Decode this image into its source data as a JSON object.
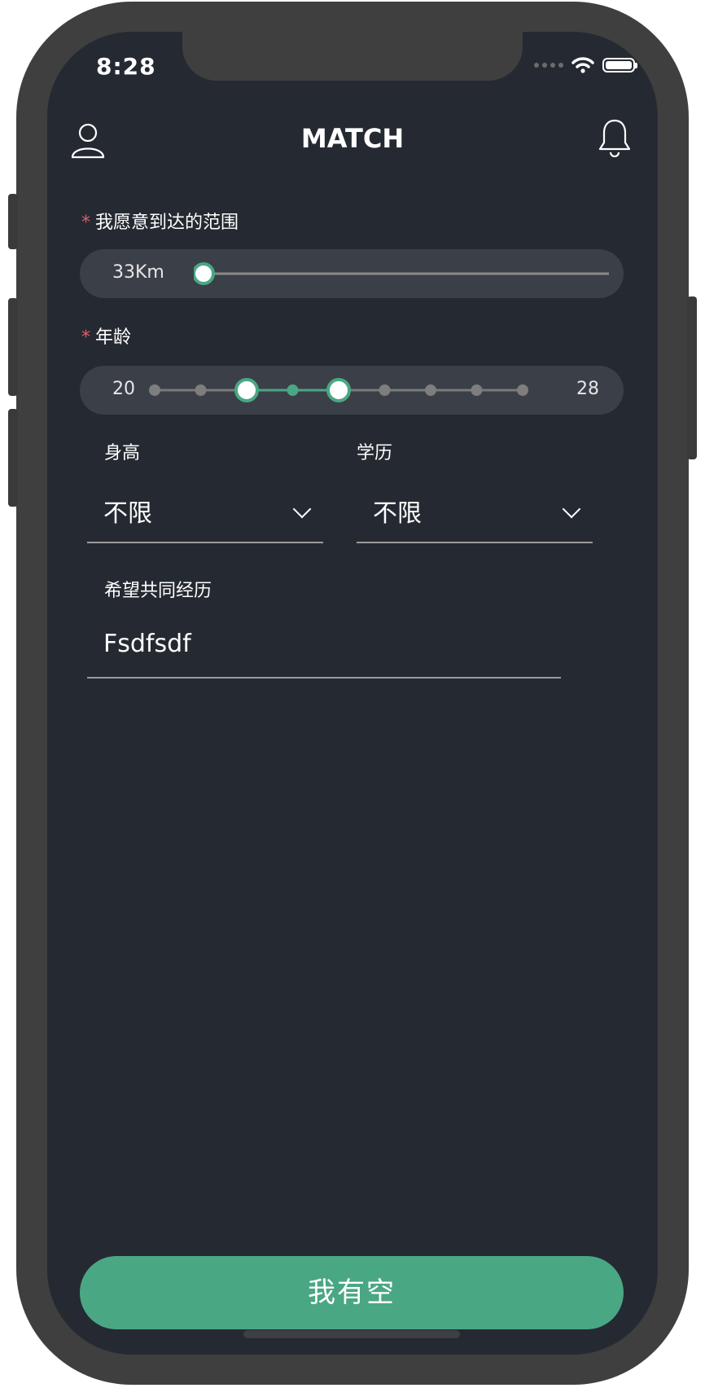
{
  "status_bar": {
    "time": "8:28"
  },
  "header": {
    "title": "MATCH",
    "left_icon": "user-icon",
    "right_icon": "bell-icon"
  },
  "colors": {
    "accent": "#4aa783",
    "background": "#252a32",
    "pill": "#3b3f47",
    "required": "#e05a68"
  },
  "distance": {
    "required_mark": "*",
    "label": "我愿意到达的范围",
    "value_text": "33Km",
    "slider_fraction": 0.0
  },
  "age": {
    "required_mark": "*",
    "label": "年龄",
    "min_label": "20",
    "max_label": "28",
    "range_start": 22,
    "range_end": 24
  },
  "height": {
    "label": "身高",
    "value": "不限"
  },
  "education": {
    "label": "学历",
    "value": "不限"
  },
  "experience": {
    "label": "希望共同经历",
    "value": "Fsdfsdf"
  },
  "cta": {
    "label": "我有空"
  }
}
